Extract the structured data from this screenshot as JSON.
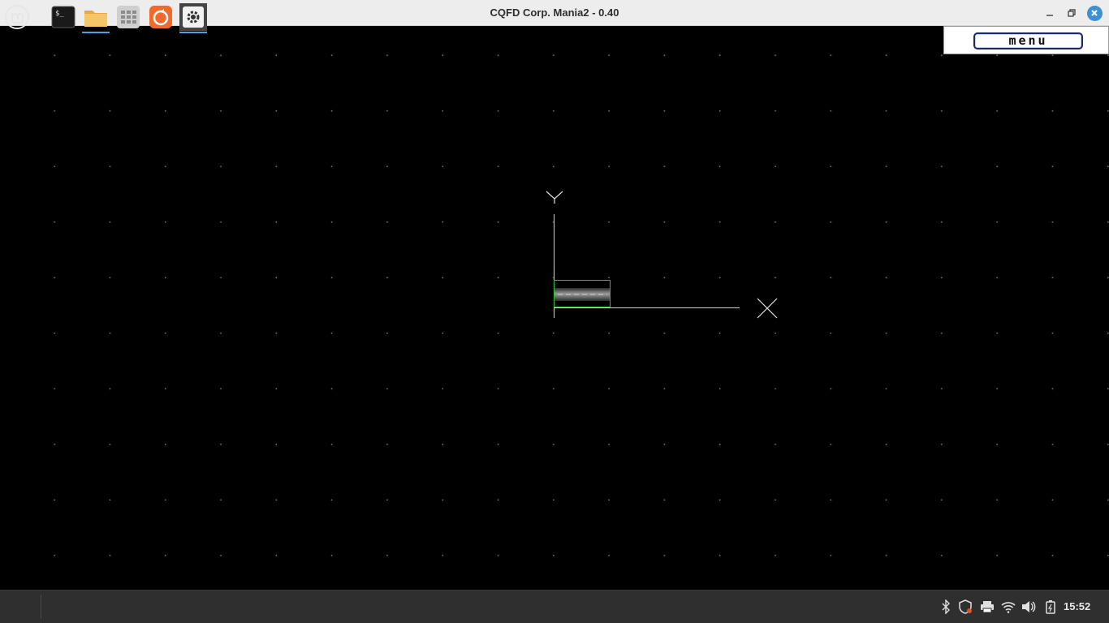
{
  "window": {
    "title": "CQFD Corp. Mania2 - 0.40"
  },
  "game": {
    "menu_label": "menu",
    "axis_y_label": "Y",
    "axis_x_label": "X"
  },
  "taskbar": {
    "apps": [
      {
        "name": "start-menu",
        "icon": "linux-mint-logo"
      },
      {
        "name": "terminal",
        "icon": "terminal-icon"
      },
      {
        "name": "files",
        "icon": "folder-icon"
      },
      {
        "name": "apps-grid",
        "icon": "grid-icon"
      },
      {
        "name": "firefox",
        "icon": "firefox-icon"
      },
      {
        "name": "settings",
        "icon": "gear-icon",
        "active": true
      }
    ],
    "tray": [
      "bluetooth-icon",
      "shield-icon",
      "printer-icon",
      "wifi-icon",
      "volume-icon",
      "battery-icon"
    ],
    "clock": "15:52"
  },
  "colors": {
    "titlebar_bg": "#ededed",
    "close_button": "#3d8fd6",
    "taskbar_bg": "#2f2f2f",
    "active_underline": "#4aa3df",
    "bbox_green": "#2fbf2f"
  }
}
